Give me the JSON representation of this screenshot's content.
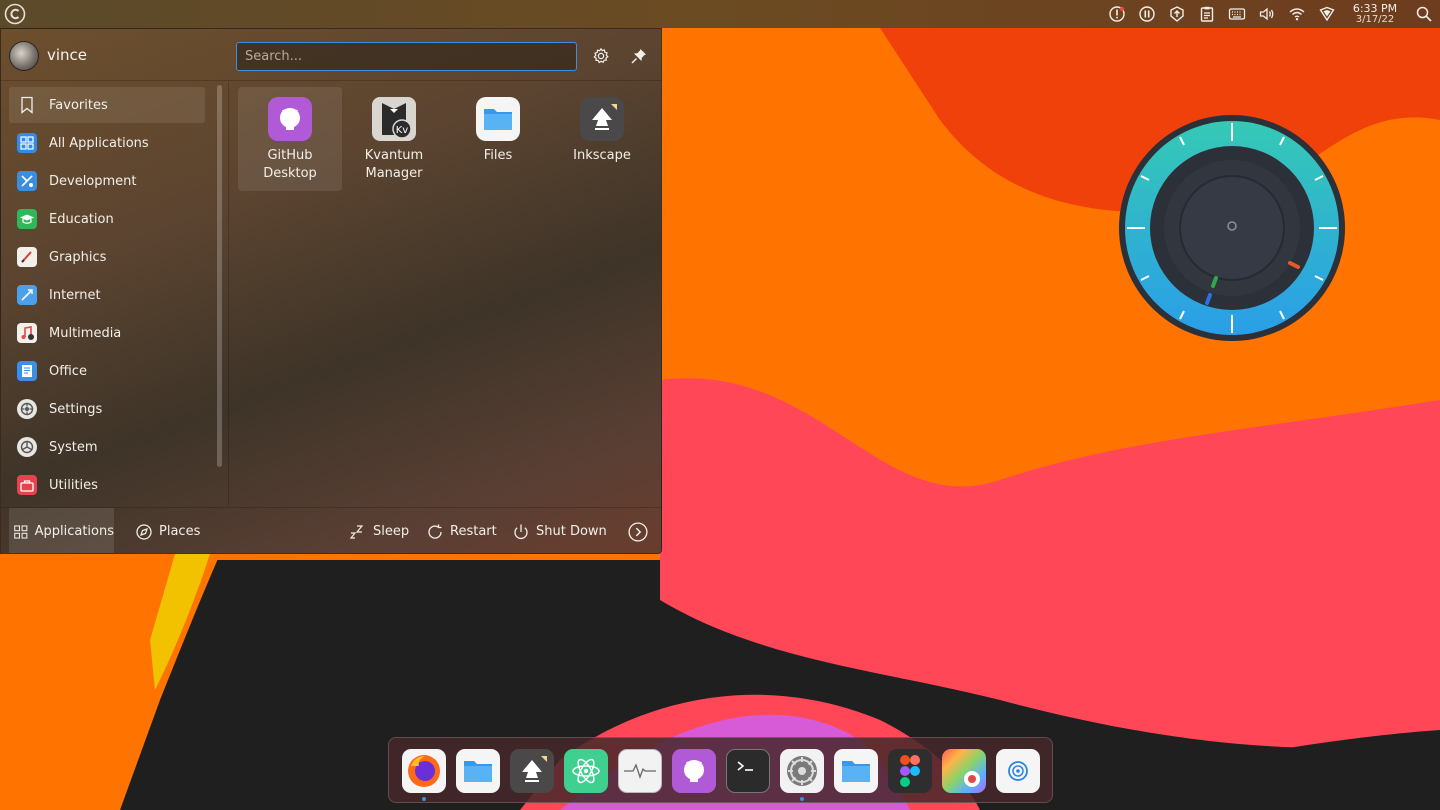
{
  "panel": {
    "clock_time": "6:33 PM",
    "clock_date": "3/17/22",
    "tray_icons": [
      "notification-alert-icon",
      "pause-icon",
      "update-icon",
      "clipboard-icon",
      "keyboard-icon",
      "volume-icon",
      "wifi-icon",
      "vpn-shield-icon",
      "search-icon"
    ]
  },
  "menu": {
    "username": "vince",
    "search_placeholder": "Search...",
    "categories": [
      {
        "label": "Favorites",
        "icon": "bookmark-icon",
        "active": true
      },
      {
        "label": "All Applications",
        "icon": "grid-icon"
      },
      {
        "label": "Development",
        "icon": "development-icon"
      },
      {
        "label": "Education",
        "icon": "education-icon"
      },
      {
        "label": "Graphics",
        "icon": "graphics-icon"
      },
      {
        "label": "Internet",
        "icon": "internet-icon"
      },
      {
        "label": "Multimedia",
        "icon": "multimedia-icon"
      },
      {
        "label": "Office",
        "icon": "office-icon"
      },
      {
        "label": "Settings",
        "icon": "settings-icon"
      },
      {
        "label": "System",
        "icon": "system-icon"
      },
      {
        "label": "Utilities",
        "icon": "utilities-icon"
      }
    ],
    "apps": [
      {
        "label": "GitHub Desktop",
        "icon": "github-desktop-icon"
      },
      {
        "label": "Kvantum Manager",
        "icon": "kvantum-manager-icon"
      },
      {
        "label": "Files",
        "icon": "files-icon"
      },
      {
        "label": "Inkscape",
        "icon": "inkscape-icon"
      }
    ],
    "footer": {
      "applications": "Applications",
      "places": "Places",
      "sleep": "Sleep",
      "restart": "Restart",
      "shutdown": "Shut Down"
    }
  },
  "dock": {
    "items": [
      {
        "icon": "firefox-icon",
        "running": true
      },
      {
        "icon": "files-icon",
        "running": false
      },
      {
        "icon": "inkscape-icon",
        "running": false
      },
      {
        "icon": "atom-icon",
        "running": false
      },
      {
        "icon": "system-monitor-icon",
        "running": false
      },
      {
        "icon": "github-desktop-icon",
        "running": false
      },
      {
        "icon": "terminal-icon",
        "running": false
      },
      {
        "icon": "system-settings-icon",
        "running": true
      },
      {
        "icon": "file-manager-icon",
        "running": false
      },
      {
        "icon": "figma-icon",
        "running": false
      },
      {
        "icon": "color-picker-icon",
        "running": false
      },
      {
        "icon": "network-icon",
        "running": false
      }
    ]
  },
  "colors": {
    "accent": "#3d8ee6",
    "wallpaper_orange": "#ff7300",
    "wallpaper_red": "#f0410a",
    "wallpaper_pink": "#ff4758",
    "wallpaper_dark": "#1f1f1f",
    "wallpaper_yellow": "#f2c100",
    "wallpaper_magenta": "#d75ad6"
  }
}
